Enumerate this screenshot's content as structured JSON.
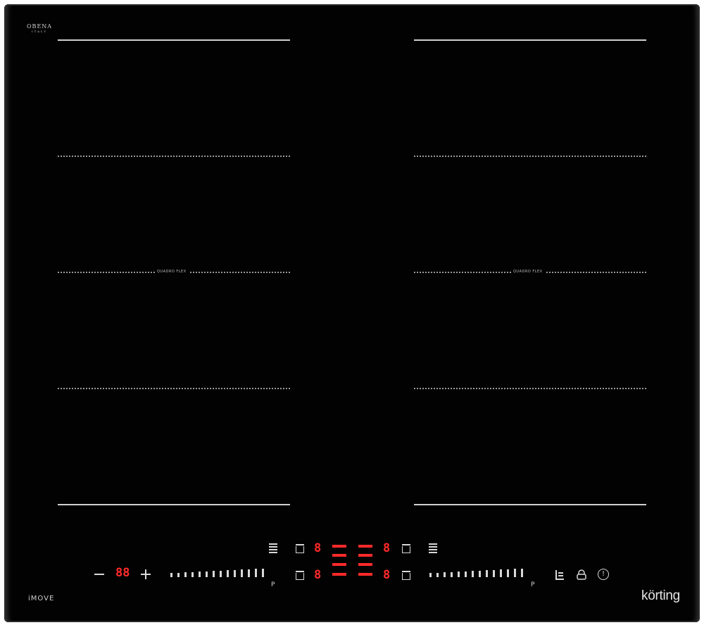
{
  "brand": {
    "top_logo": "OBENA",
    "top_logo_sub": "ITALY",
    "model_logo": "iMOVE",
    "maker_logo": "körting"
  },
  "zones": {
    "left_label": "QUADRO FLEX",
    "right_label": "QUADRO FLEX"
  },
  "timer": {
    "display": "88",
    "minus_icon": "minus-icon",
    "plus_icon": "plus-icon"
  },
  "sliders": {
    "left_boost_label": "P",
    "right_boost_label": "P"
  },
  "zone_displays": {
    "top_left": "8",
    "bottom_left": "8",
    "top_right": "8",
    "bottom_right": "8"
  },
  "controls": {
    "pause_icon": "pause-icon",
    "lock_icon": "lock-icon",
    "power_icon": "power-icon"
  },
  "colors": {
    "glass": "#020202",
    "indicator": "#ff2a2a",
    "printing": "#d8d8d8"
  }
}
